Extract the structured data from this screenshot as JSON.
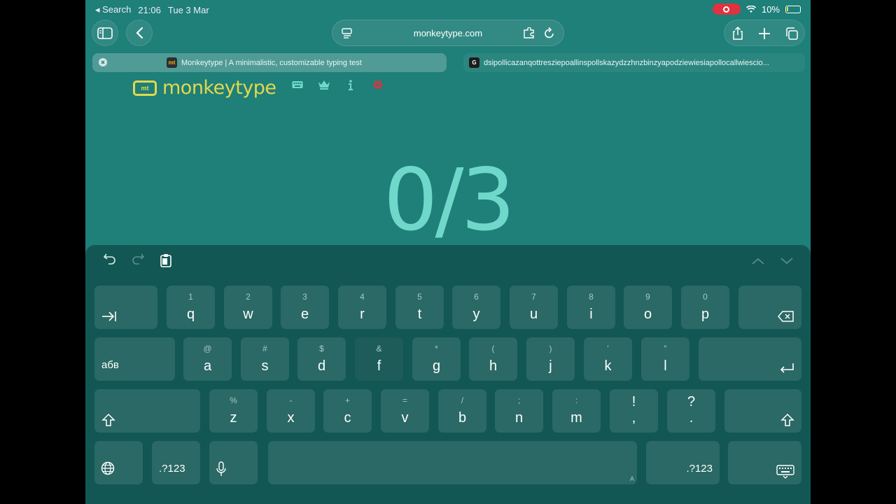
{
  "status_bar": {
    "back_app": "Search",
    "time": "21:06",
    "date": "Tue 3 Mar",
    "battery": "10%"
  },
  "browser": {
    "url": "monkeytype.com",
    "tabs": [
      {
        "title": "Monkeytype | A minimalistic, customizable typing test",
        "favicon": "mt",
        "active": true
      },
      {
        "title": "dsipollicazanqottresziepoallinspollskazydzzhnzbinzyapodziewiesiapollocallwiescio...",
        "favicon": "G",
        "active": false
      }
    ]
  },
  "monkeytype": {
    "logo_text": "monkeytype",
    "logo_icon": "mt",
    "counter": "0/3",
    "colors": {
      "background": "#1f7f79",
      "logo": "#e2d94b",
      "counter": "#6fd8cb",
      "settings": "#e0323f"
    }
  },
  "keyboard": {
    "row1": [
      {
        "main": "q",
        "sec": "1"
      },
      {
        "main": "w",
        "sec": "2"
      },
      {
        "main": "e",
        "sec": "3"
      },
      {
        "main": "r",
        "sec": "4"
      },
      {
        "main": "t",
        "sec": "5"
      },
      {
        "main": "y",
        "sec": "6"
      },
      {
        "main": "u",
        "sec": "7"
      },
      {
        "main": "i",
        "sec": "8"
      },
      {
        "main": "o",
        "sec": "9"
      },
      {
        "main": "p",
        "sec": "0"
      }
    ],
    "row2": [
      {
        "main": "a",
        "sec": "@"
      },
      {
        "main": "s",
        "sec": "#"
      },
      {
        "main": "d",
        "sec": "$"
      },
      {
        "main": "f",
        "sec": "&"
      },
      {
        "main": "g",
        "sec": "*"
      },
      {
        "main": "h",
        "sec": "("
      },
      {
        "main": "j",
        "sec": ")"
      },
      {
        "main": "k",
        "sec": "'"
      },
      {
        "main": "l",
        "sec": "\""
      }
    ],
    "row3": [
      {
        "main": "z",
        "sec": "%"
      },
      {
        "main": "x",
        "sec": "-"
      },
      {
        "main": "c",
        "sec": "+"
      },
      {
        "main": "v",
        "sec": "="
      },
      {
        "main": "b",
        "sec": "/"
      },
      {
        "main": "n",
        "sec": ";"
      },
      {
        "main": "m",
        "sec": ":"
      },
      {
        "main": ",",
        "sec": "!"
      },
      {
        "main": ".",
        "sec": "?"
      }
    ],
    "lang_label": "абв",
    "numbers_label": ".?123",
    "space_hint": "A"
  }
}
